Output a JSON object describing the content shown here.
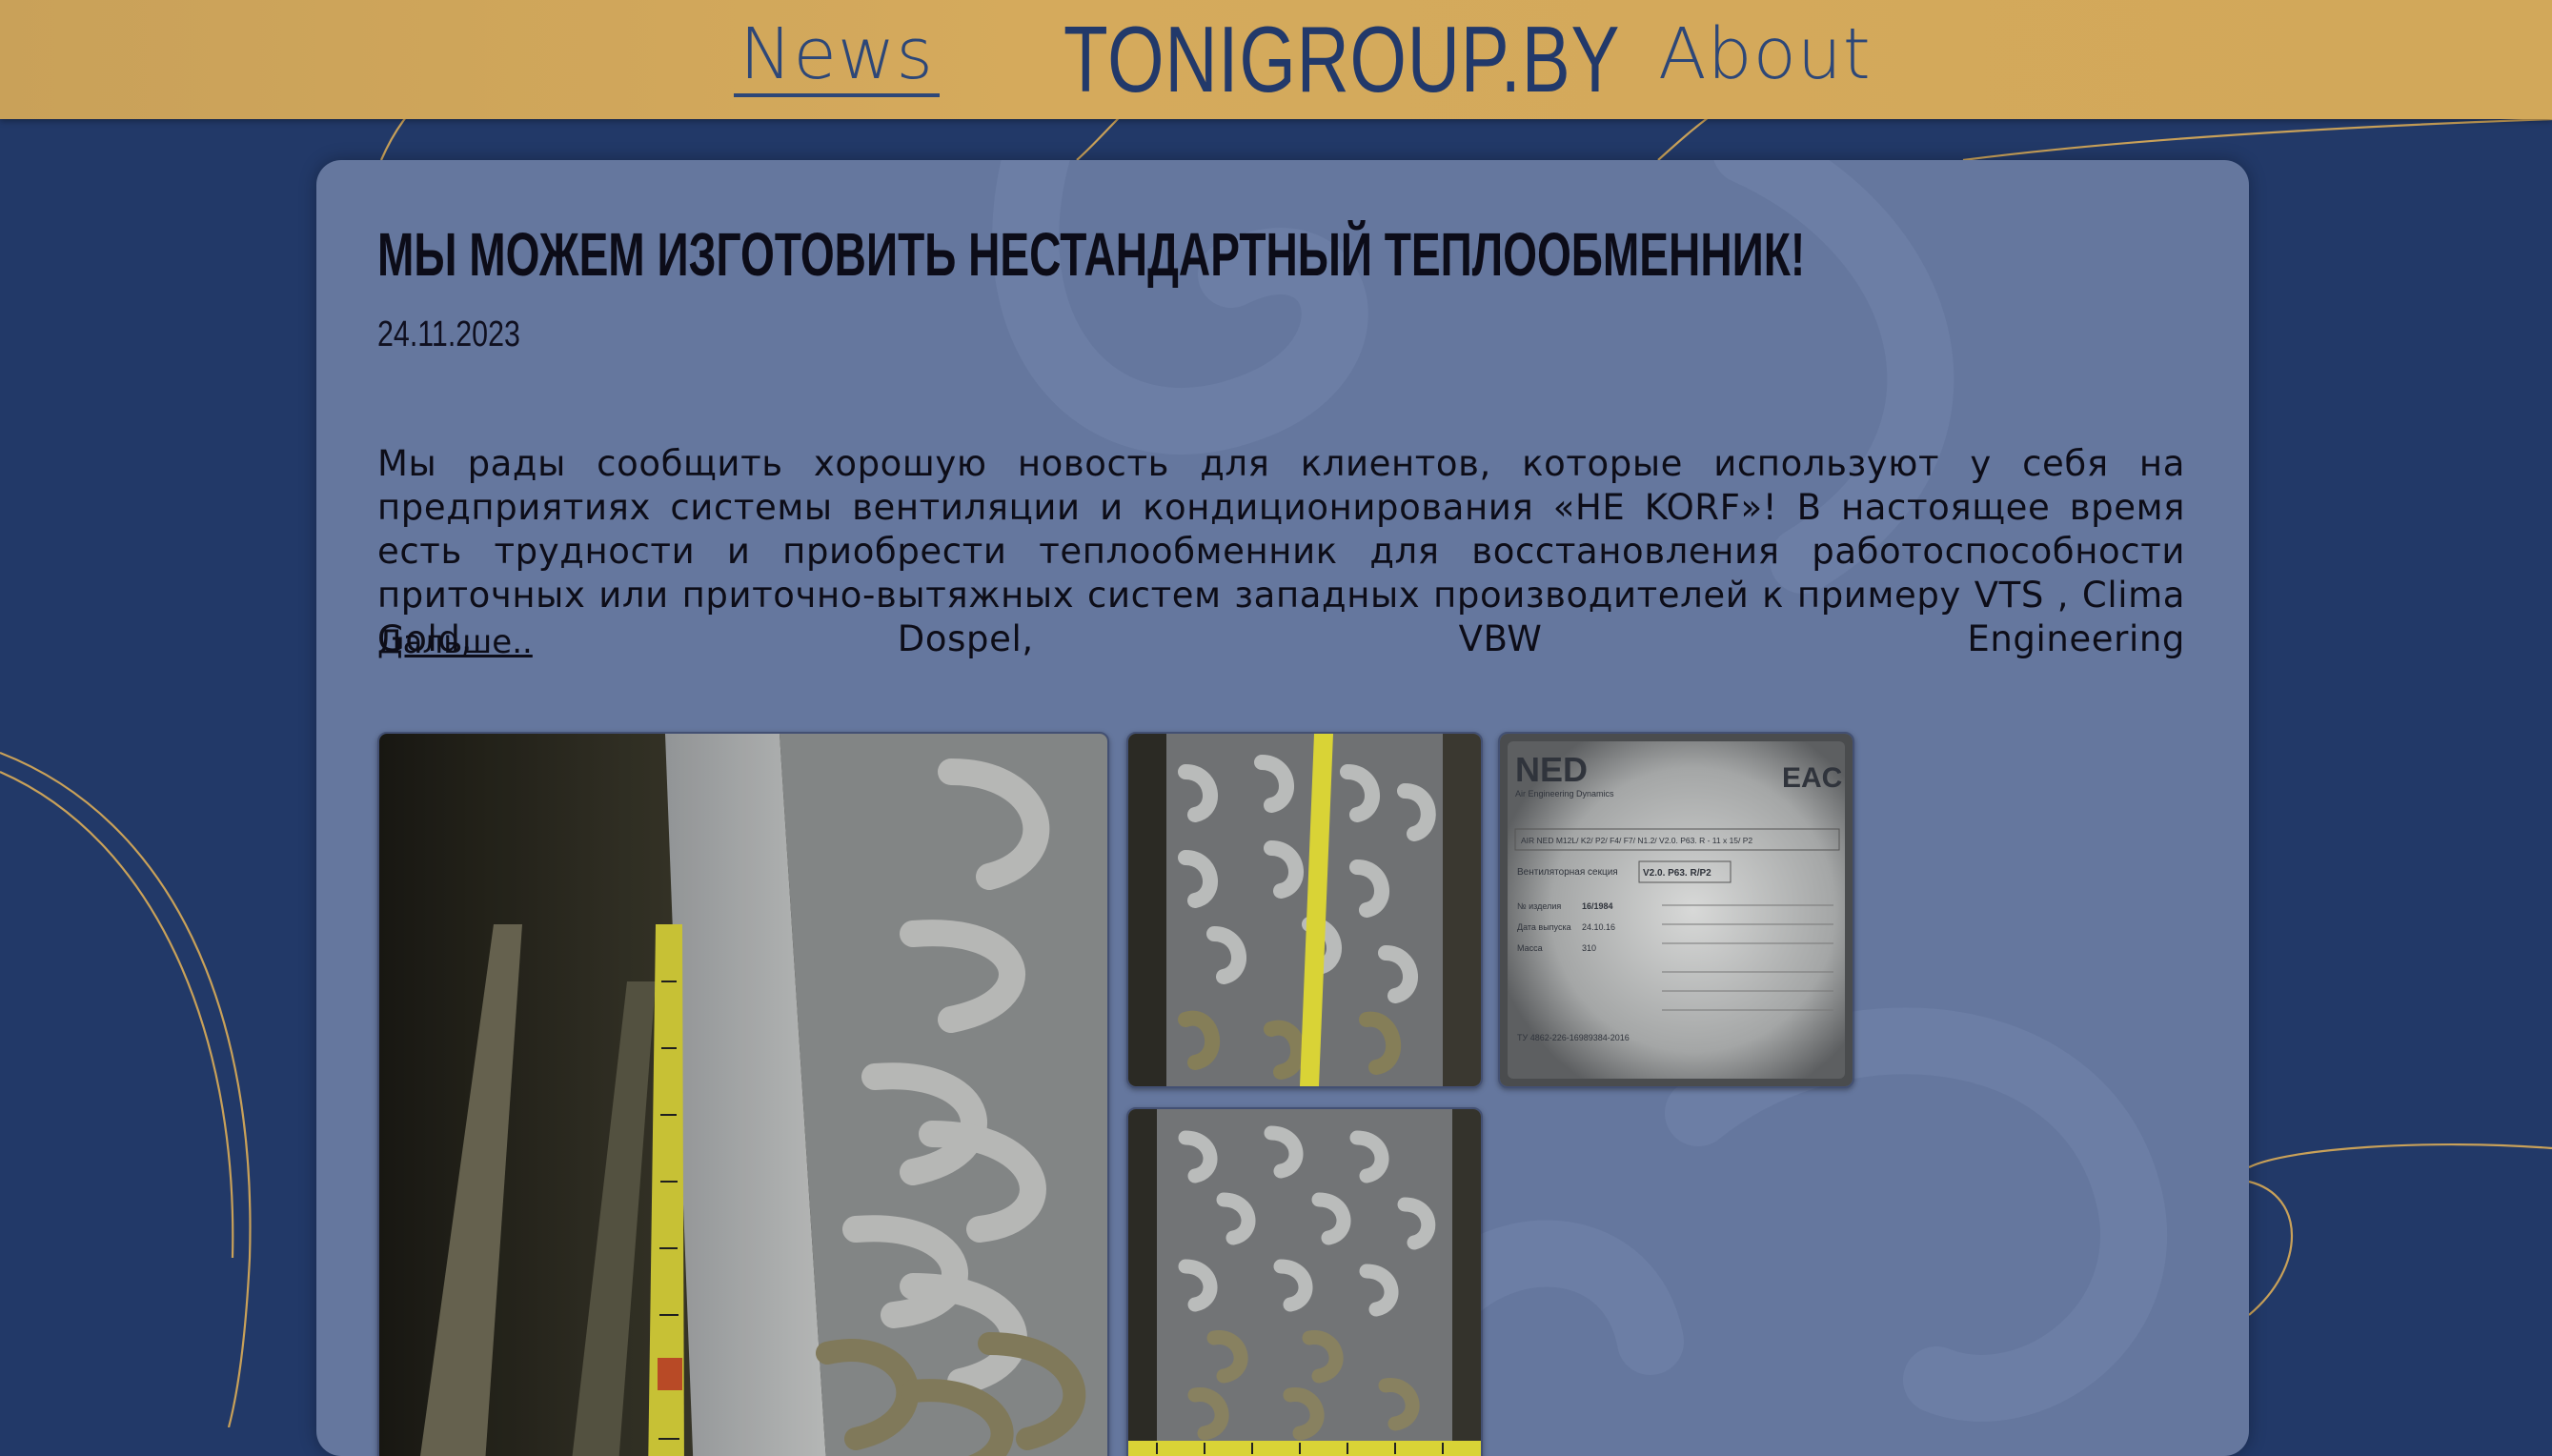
{
  "header": {
    "nav_news": "News",
    "logo": "TONIGROUP.BY",
    "nav_about": "About"
  },
  "article": {
    "title": "Мы можем изготовить нестандартный теплообменник!",
    "date": "24.11.2023",
    "body": "Мы рады сообщить хорошую новость для клиентов, которые используют у себя на предприятиях системы вентиляции и кондиционирования «НЕ KORF»! В настоящее время есть трудности и приобрести теплообменник для восстановления работоспособности приточных или приточно-вытяжных систем западных производителей к примеру VTS , Clima Gold, Dospel, VBW Engineering",
    "more_link": "Дальше.."
  },
  "gallery": {
    "nameplate": {
      "brand": "NED",
      "brand_sub": "Air Engineering Dynamics",
      "cert_mark": "EAC",
      "model_line": "AIR NED M12L/ K2/ P2/ F4/ F7/ N1.2/ V2.0. P63. R - 11 x 15/ P2",
      "section_label": "Вентиляторная секция",
      "section_value": "V2.0. P63. R/P2",
      "serial_label": "№ изделия",
      "serial_value": "16/1984",
      "date_label": "Дата выпуска",
      "date_value": "24.10.16",
      "mass_label": "Масса",
      "mass_value": "310",
      "spec": "ТУ 4862-226-16989384-2016"
    }
  },
  "colors": {
    "page_bg": "#223968",
    "header_bg": "#d3a85b",
    "nav_text": "#2d4778",
    "card_bg": "#65779e",
    "decor_line": "#c9a159"
  }
}
